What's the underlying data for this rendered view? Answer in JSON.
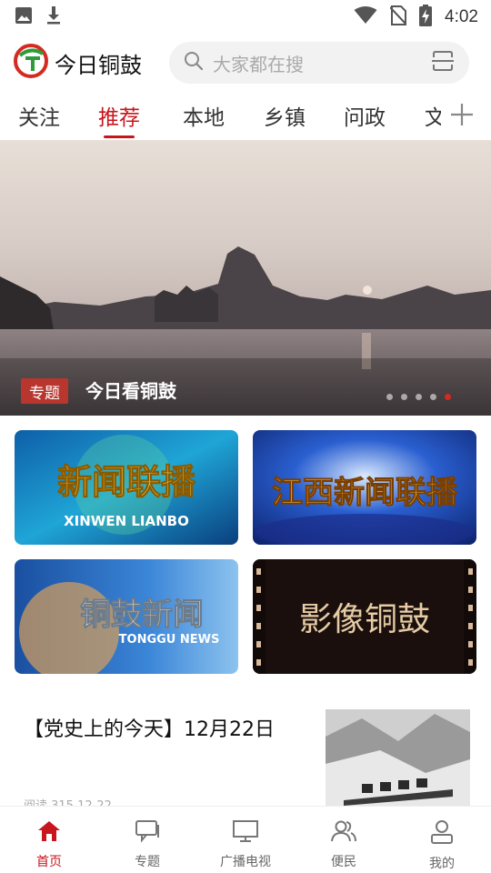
{
  "status_bar": {
    "time": "4:02",
    "icons": [
      "image-icon",
      "download-icon",
      "wifi-icon",
      "no-sim-icon",
      "battery-charging-icon"
    ]
  },
  "header": {
    "app_name": "今日铜鼓",
    "search": {
      "placeholder": "大家都在搜"
    }
  },
  "tabs": [
    {
      "label": "关注",
      "active": false
    },
    {
      "label": "推荐",
      "active": true
    },
    {
      "label": "本地",
      "active": false
    },
    {
      "label": "乡镇",
      "active": false
    },
    {
      "label": "问政",
      "active": false
    },
    {
      "label": "文",
      "active": false
    }
  ],
  "banner": {
    "tag": "专题",
    "title": "今日看铜鼓",
    "total_slides": 5,
    "active_slide": 5
  },
  "tiles": [
    {
      "title": "新闻联播",
      "subtitle": "XINWEN LIANBO"
    },
    {
      "title": "江西新闻联播",
      "subtitle": ""
    },
    {
      "title": "铜鼓新闻",
      "subtitle": "TONGGU NEWS"
    },
    {
      "title": "影像铜鼓",
      "subtitle": ""
    }
  ],
  "news": {
    "title": "【党史上的今天】12月22日",
    "meta": "阅读 315 12-22"
  },
  "bottom_nav": [
    {
      "label": "首页",
      "icon": "home-icon",
      "active": true
    },
    {
      "label": "专题",
      "icon": "topic-chat-icon",
      "active": false
    },
    {
      "label": "广播电视",
      "icon": "tv-icon",
      "active": false
    },
    {
      "label": "便民",
      "icon": "people-icon",
      "active": false
    },
    {
      "label": "我的",
      "icon": "user-icon",
      "active": false
    }
  ],
  "colors": {
    "accent": "#c8161d",
    "tag_bg": "#b8362d"
  }
}
